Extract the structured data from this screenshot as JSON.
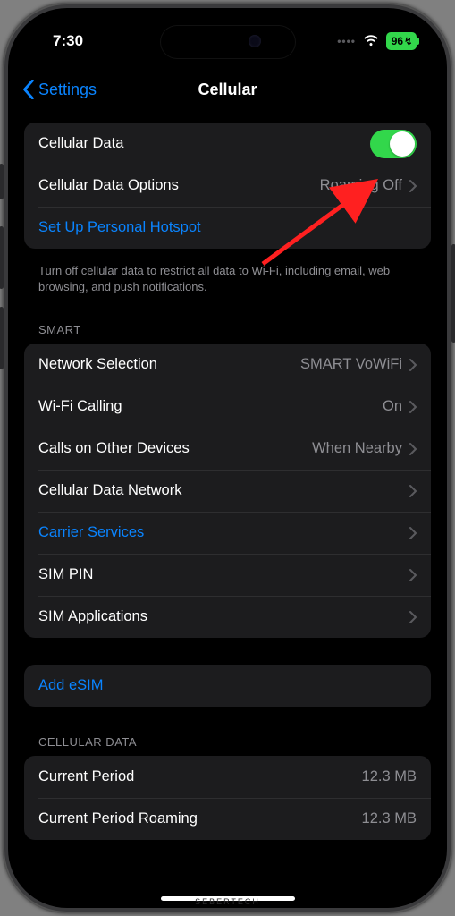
{
  "status": {
    "time": "7:30",
    "battery_pct": "96",
    "dots": "••••"
  },
  "nav": {
    "back_label": "Settings",
    "title": "Cellular"
  },
  "group1": {
    "cellular_data_label": "Cellular Data",
    "cellular_data_on": true,
    "options_label": "Cellular Data Options",
    "options_value": "Roaming Off",
    "hotspot_label": "Set Up Personal Hotspot",
    "footer": "Turn off cellular data to restrict all data to Wi-Fi, including email, web browsing, and push notifications."
  },
  "smart": {
    "header": "SMART",
    "network_selection_label": "Network Selection",
    "network_selection_value": "SMART VoWiFi",
    "wifi_calling_label": "Wi-Fi Calling",
    "wifi_calling_value": "On",
    "calls_other_label": "Calls on Other Devices",
    "calls_other_value": "When Nearby",
    "data_network_label": "Cellular Data Network",
    "carrier_services_label": "Carrier Services",
    "sim_pin_label": "SIM PIN",
    "sim_apps_label": "SIM Applications"
  },
  "esim": {
    "add_label": "Add eSIM"
  },
  "cellular_data_section": {
    "header": "CELLULAR DATA",
    "current_period_label": "Current Period",
    "current_period_value": "12.3 MB",
    "roaming_label": "Current Period Roaming",
    "roaming_value": "12.3 MB"
  },
  "annotation": {
    "arrow_color": "#ff2020"
  },
  "watermark": "SEBERTECH"
}
